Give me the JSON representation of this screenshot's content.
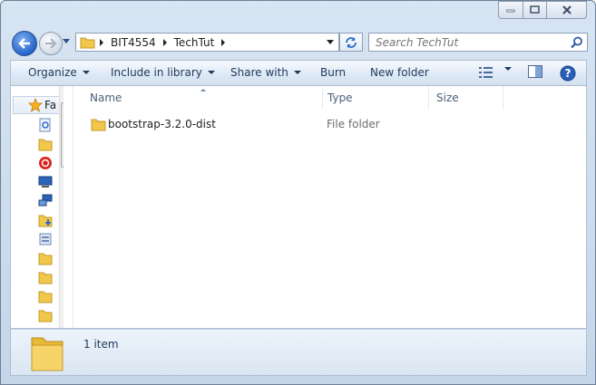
{
  "address": {
    "crumbs": [
      "BIT4554",
      "TechTut"
    ]
  },
  "search": {
    "placeholder": "Search TechTut"
  },
  "toolbar": {
    "organize": "Organize",
    "include_in_library": "Include in library",
    "share_with": "Share with",
    "burn": "Burn",
    "new_folder": "New folder"
  },
  "nav_pane": {
    "favorites_label": "Fa"
  },
  "columns": {
    "name": "Name",
    "type": "Type",
    "size": "Size"
  },
  "files": [
    {
      "name": "bootstrap-3.2.0-dist",
      "type": "File folder",
      "size": ""
    }
  ],
  "details": {
    "item_count": "1 item"
  },
  "colors": {
    "folder": "#f2c84b",
    "accent": "#2563c9"
  }
}
